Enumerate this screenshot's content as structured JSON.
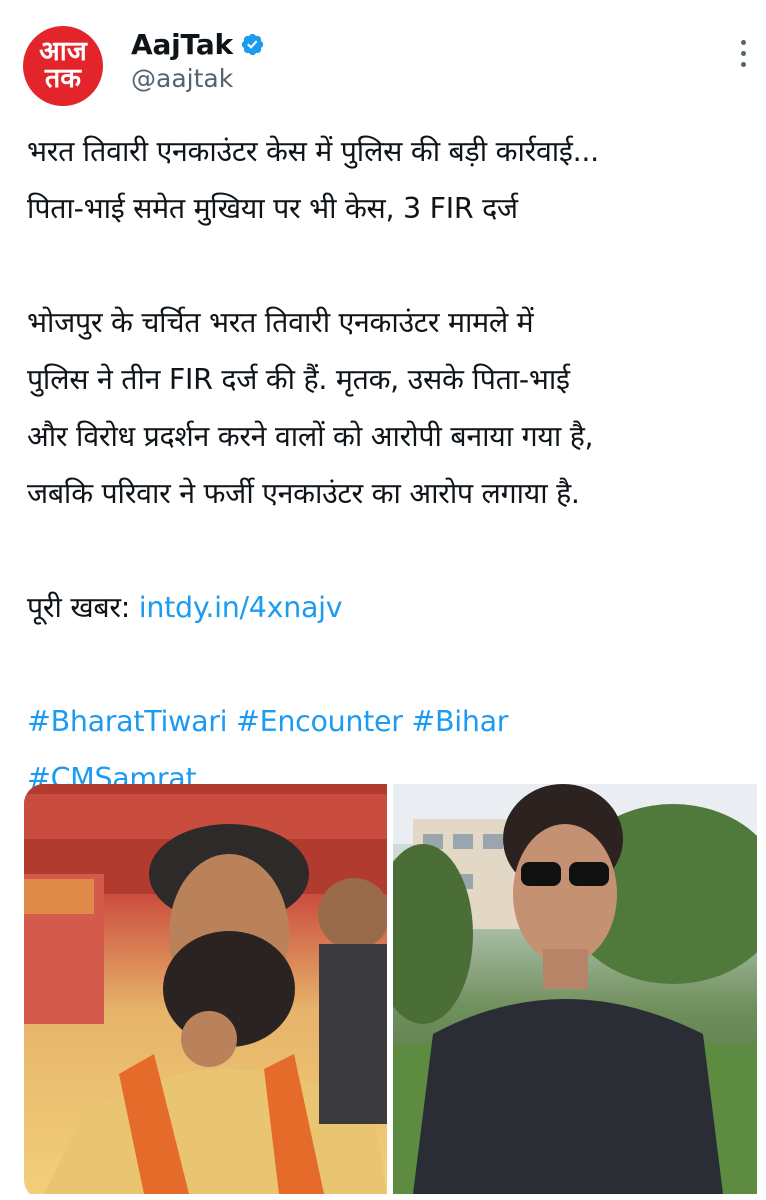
{
  "account": {
    "avatar_line1": "आज",
    "avatar_line2": "तक",
    "name": "AajTak",
    "handle": "@aajtak",
    "verified": true
  },
  "icons": {
    "verified": "verified-badge-icon",
    "more": "more-vertical-icon"
  },
  "tweet": {
    "headline": [
      "भरत तिवारी एनकाउंटर केस में पुलिस की बड़ी कार्रवाई...",
      "पिता-भाई समेत मुखिया पर भी केस, 3 FIR दर्ज"
    ],
    "body": [
      "भोजपुर के चर्चित भरत तिवारी एनकाउंटर मामले में",
      "पुलिस ने तीन FIR दर्ज की हैं. मृतक, उसके पिता-भाई",
      "और विरोध प्रदर्शन करने वालों को आरोपी बनाया गया है,",
      "जबकि परिवार ने फर्जी एनकाउंटर का आरोप लगाया है."
    ],
    "full_story_label": "पूरी खबर:",
    "link": "intdy.in/4xnajv",
    "hashtags_line1": [
      "#BharatTiwari",
      "#Encounter",
      "#Bihar"
    ],
    "hashtags_line2": [
      "#CMSamrat"
    ]
  },
  "media": {
    "count": 2
  },
  "colors": {
    "link": "#1d9bf0",
    "text": "#0f1419",
    "secondary": "#536471",
    "brand_red": "#e3252b"
  }
}
